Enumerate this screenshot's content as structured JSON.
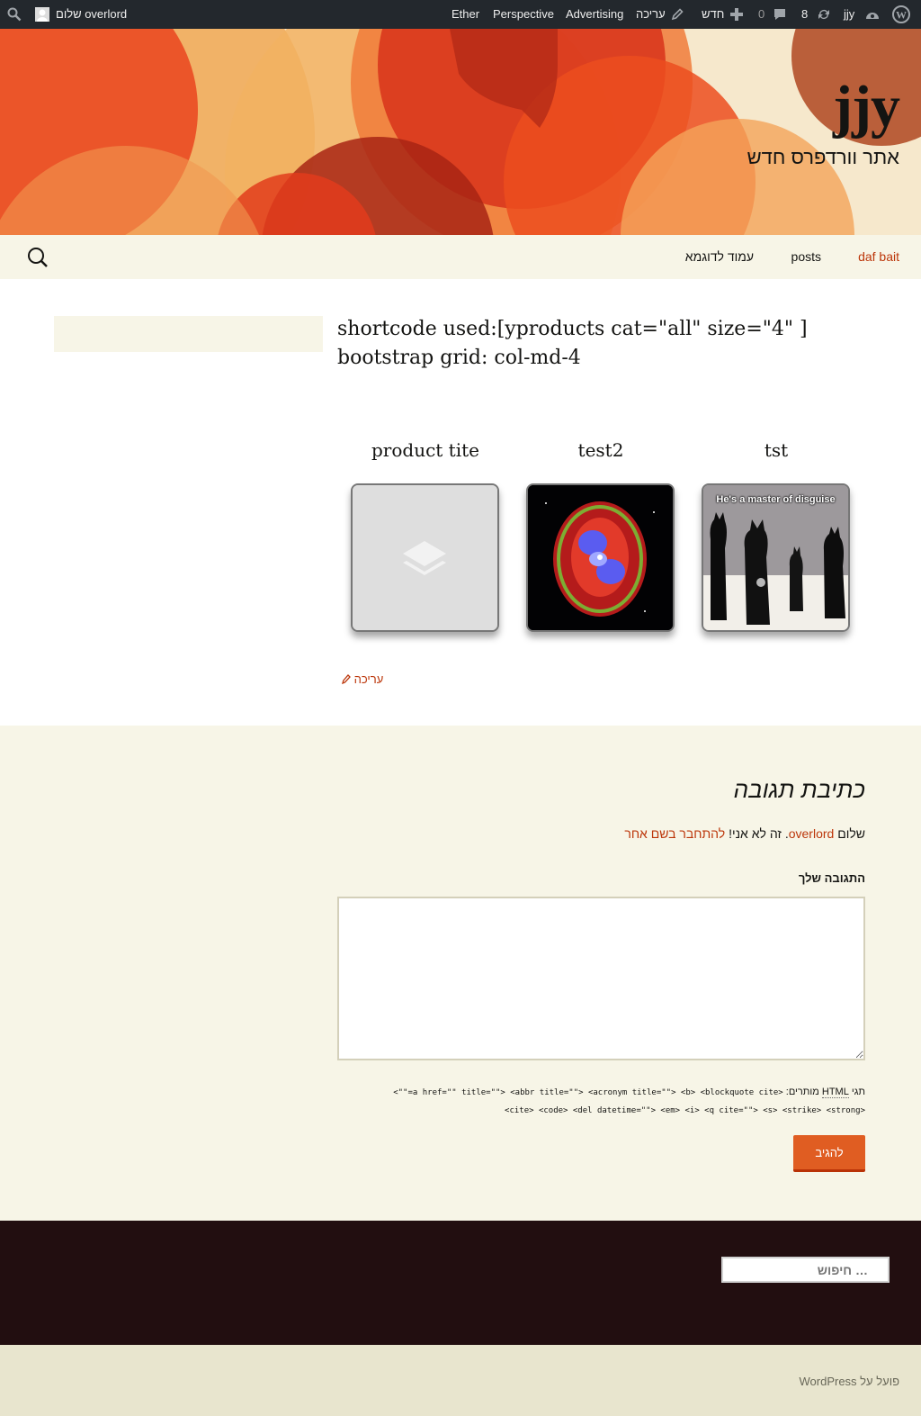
{
  "admin_bar": {
    "wp_logo_icon": "wordpress-logo-icon",
    "site_name": "jjy",
    "updates_count": "8",
    "comments_count": "0",
    "new_label": "חדש",
    "edit_label": "עריכה",
    "links": [
      "Advertising",
      "Perspective",
      "Ether"
    ],
    "greeting": "שלום overlord"
  },
  "header": {
    "title": "jjy",
    "description": "אתר וורדפרס חדש"
  },
  "nav": {
    "items": [
      "daf bait",
      "posts",
      "עמוד לדוגמא"
    ],
    "active_color": "#bc360a"
  },
  "entry": {
    "title_line1": "shortcode used:[yproducts cat=\"all\" size=\"4\" ]",
    "title_line2": "bootstrap grid: col-md-4",
    "products": [
      {
        "title": "tst",
        "image_caption": "He's a master of disguise"
      },
      {
        "title": "test2"
      },
      {
        "title": "product tite"
      }
    ],
    "edit_link": "עריכה"
  },
  "comments": {
    "reply_title": "כתיבת תגובה",
    "logged_in_prefix": "שלום",
    "logged_in_user": "overlord",
    "logged_in_mid": ". זה לא אני!",
    "logout_link": "להתחבר בשם אחר",
    "comment_label": "התגובה שלך",
    "allowed_prefix": "תגי",
    "allowed_html": "HTML",
    "allowed_suffix": "מותרים:",
    "allowed_tags_line1": "<a href=\"\" title=\"\"> <abbr title=\"\"> <acronym title=\"\"> <b> <blockquote cite=\"\">",
    "allowed_tags_line2": "<cite> <code> <del datetime=\"\"> <em> <i> <q cite=\"\"> <s> <strike> <strong>",
    "submit_label": "להגיב"
  },
  "footer": {
    "search_placeholder": "חיפוש …",
    "credit": "פועל על WordPress"
  },
  "colors": {
    "accent": "#bc360a",
    "button": "#e05d22",
    "footer_dark": "#220e10"
  }
}
